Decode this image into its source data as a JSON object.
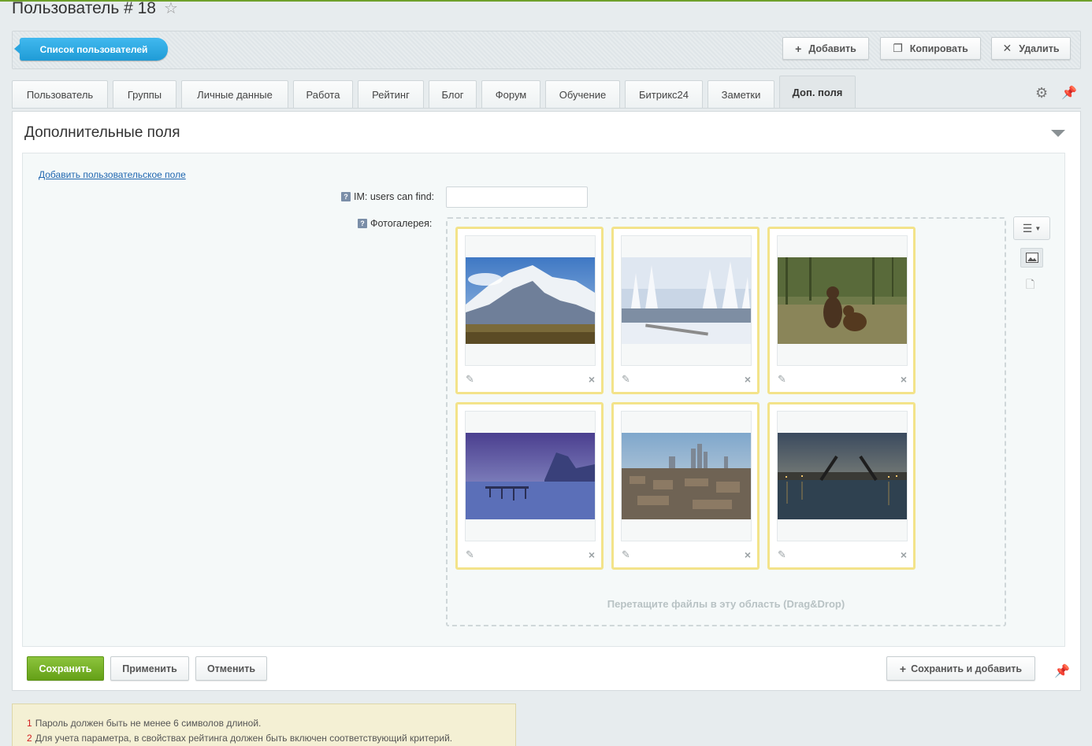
{
  "page": {
    "title": "Пользователь # 18"
  },
  "toolbar": {
    "list_label": "Список пользователей",
    "add_label": "Добавить",
    "copy_label": "Копировать",
    "delete_label": "Удалить"
  },
  "tabs": [
    {
      "label": "Пользователь"
    },
    {
      "label": "Группы"
    },
    {
      "label": "Личные данные"
    },
    {
      "label": "Работа"
    },
    {
      "label": "Рейтинг"
    },
    {
      "label": "Блог"
    },
    {
      "label": "Форум"
    },
    {
      "label": "Обучение"
    },
    {
      "label": "Битрикс24"
    },
    {
      "label": "Заметки"
    },
    {
      "label": "Доп. поля",
      "active": true
    }
  ],
  "section": {
    "title": "Дополнительные поля",
    "add_field_link": "Добавить пользовательское поле",
    "im_label": "IM: users can find:",
    "im_value": "",
    "gallery_label": "Фотогалерея:",
    "dropzone_text": "Перетащите файлы в эту область (Drag&Drop)",
    "photos": [
      {
        "subject": "snowy mountain"
      },
      {
        "subject": "winter forest river"
      },
      {
        "subject": "bears in meadow"
      },
      {
        "subject": "cliff over sea at dusk"
      },
      {
        "subject": "city skyline"
      },
      {
        "subject": "drawbridge at night"
      }
    ]
  },
  "footer": {
    "save_label": "Сохранить",
    "apply_label": "Применить",
    "cancel_label": "Отменить",
    "save_add_label": "Сохранить и добавить"
  },
  "notes": [
    {
      "num": "1",
      "text": "Пароль должен быть не менее 6 символов длиной."
    },
    {
      "num": "2",
      "text": "Для учета параметра, в свойствах рейтинга должен быть включен соответствующий критерий."
    }
  ],
  "colors": {
    "accent_blue": "#1f9bd6",
    "save_green": "#64a017",
    "card_border": "#f3e38a"
  }
}
